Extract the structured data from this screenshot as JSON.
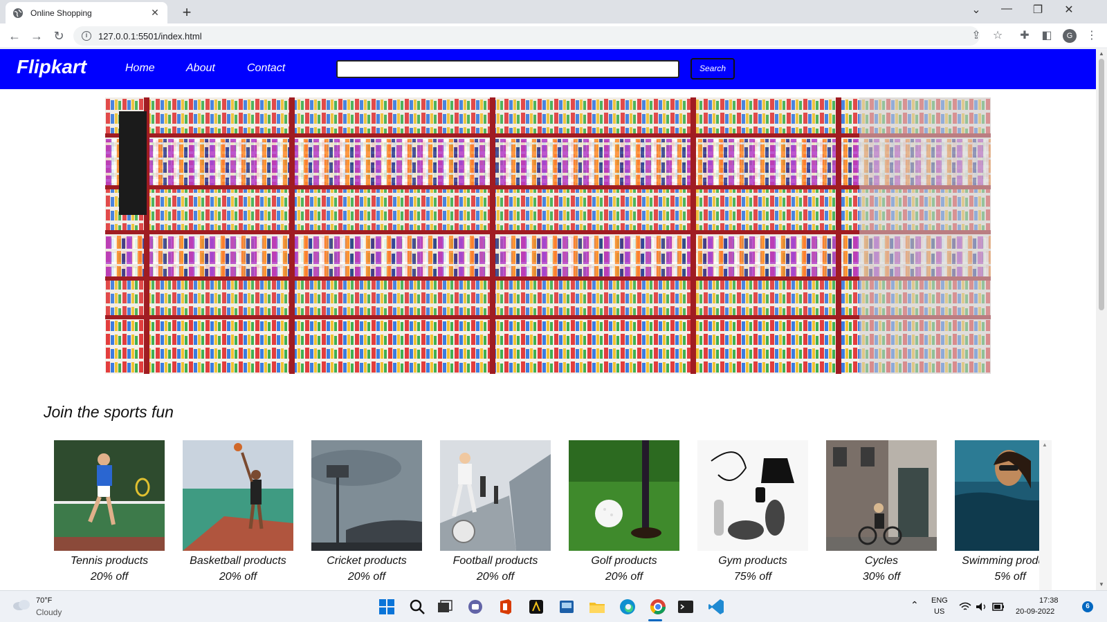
{
  "browser": {
    "tab_title": "Online Shopping",
    "url": "127.0.0.1:5501/index.html",
    "profile_initial": "G"
  },
  "site": {
    "logo": "Flipkart",
    "nav": [
      "Home",
      "About",
      "Contact"
    ],
    "search_value": "",
    "search_button": "Search",
    "brand_color": "#0000ff"
  },
  "section": {
    "title": "Join the sports fun"
  },
  "products": [
    {
      "name": "Tennis products",
      "discount": "20% off"
    },
    {
      "name": "Basketball products",
      "discount": "20% off"
    },
    {
      "name": "Cricket products",
      "discount": "20% off"
    },
    {
      "name": "Football products",
      "discount": "20% off"
    },
    {
      "name": "Golf products",
      "discount": "20% off"
    },
    {
      "name": "Gym products",
      "discount": "75% off"
    },
    {
      "name": "Cycles",
      "discount": "30% off"
    },
    {
      "name": "Swimming products",
      "discount": "5% off"
    }
  ],
  "taskbar": {
    "weather_temp": "70°F",
    "weather_condition": "Cloudy",
    "lang": "ENG",
    "region": "US",
    "time": "17:38",
    "date": "20-09-2022",
    "notifications": "6"
  }
}
